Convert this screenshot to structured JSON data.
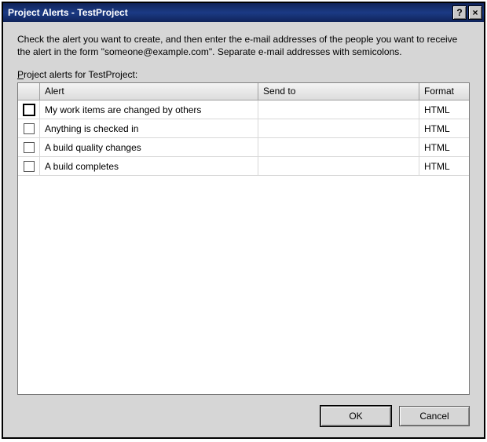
{
  "window": {
    "title": "Project Alerts - TestProject",
    "help_glyph": "?",
    "close_glyph": "×"
  },
  "instruction": "Check the alert you want to create, and then enter the e-mail addresses of the people you want to receive the alert in the form \"someone@example.com\". Separate e-mail addresses with semicolons.",
  "list_label_prefix": "P",
  "list_label_rest": "roject alerts for TestProject:",
  "columns": {
    "alert": "Alert",
    "sendto": "Send to",
    "format": "Format"
  },
  "rows": [
    {
      "checked": false,
      "focused": true,
      "alert": "My work items are changed by others",
      "sendto": "",
      "format": "HTML"
    },
    {
      "checked": false,
      "focused": false,
      "alert": "Anything is checked in",
      "sendto": "",
      "format": "HTML"
    },
    {
      "checked": false,
      "focused": false,
      "alert": "A build quality changes",
      "sendto": "",
      "format": "HTML"
    },
    {
      "checked": false,
      "focused": false,
      "alert": "A build completes",
      "sendto": "",
      "format": "HTML"
    }
  ],
  "buttons": {
    "ok": "OK",
    "cancel": "Cancel"
  }
}
